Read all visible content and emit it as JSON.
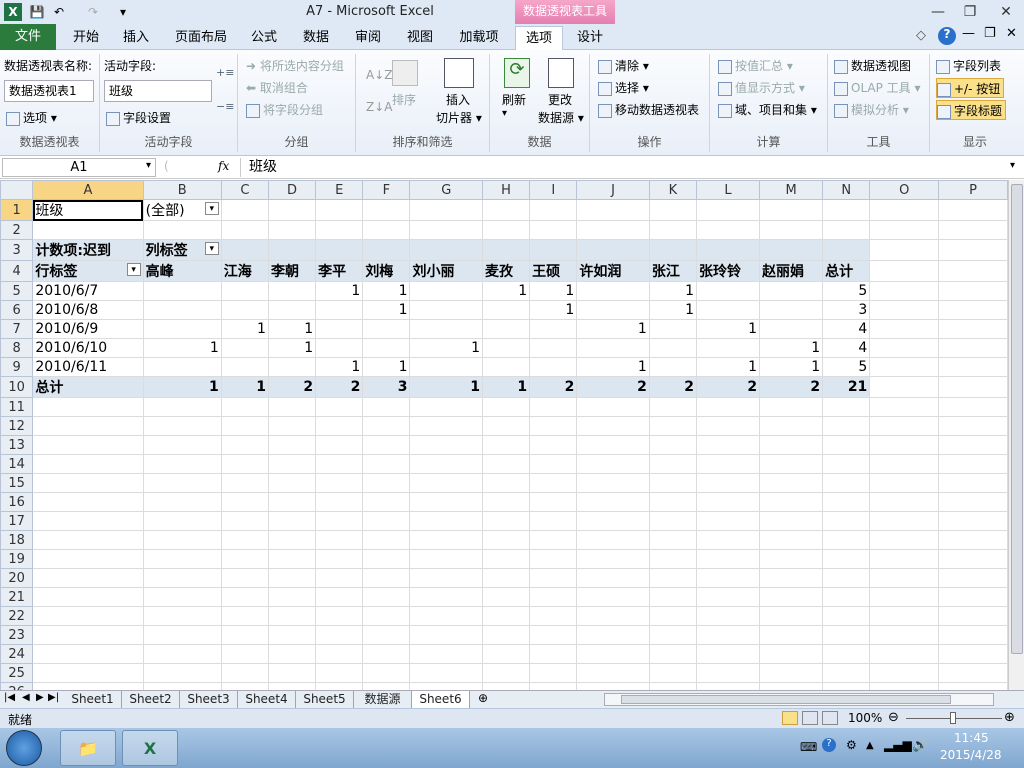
{
  "window": {
    "title": "A7  -  Microsoft Excel",
    "context_tab_title": "数据透视表工具"
  },
  "qat": {
    "save_icon": "save-icon",
    "undo_icon": "undo-icon",
    "redo_icon": "redo-icon",
    "customize_icon": "chevron-down-icon"
  },
  "window_controls": {
    "minimize": "—",
    "restore": "❐",
    "close": "✕"
  },
  "tabs": {
    "file": "文件",
    "home": "开始",
    "insert": "插入",
    "page_layout": "页面布局",
    "formulas": "公式",
    "data": "数据",
    "review": "审阅",
    "view": "视图",
    "addins": "加载项",
    "options": "选项",
    "design": "设计"
  },
  "ribbon": {
    "pivottable": {
      "name_label": "数据透视表名称:",
      "name_value": "数据透视表1",
      "options": "选项 ▾",
      "group": "数据透视表"
    },
    "active_field": {
      "label": "活动字段:",
      "value": "班级",
      "settings": "字段设置",
      "group": "活动字段"
    },
    "group": {
      "group_selection": "将所选内容分组",
      "ungroup": "取消组合",
      "group_field": "将字段分组",
      "group": "分组"
    },
    "sort": {
      "sort": "排序",
      "insert_slicer": "插入",
      "insert_slicer2": "切片器 ▾",
      "group": "排序和筛选"
    },
    "data": {
      "refresh": "刷新",
      "change_source": "更改",
      "change_source2": "数据源 ▾",
      "group": "数据"
    },
    "actions": {
      "clear": "清除 ▾",
      "select": "选择 ▾",
      "move": "移动数据透视表",
      "group": "操作"
    },
    "calculations": {
      "summarize": "按值汇总 ▾",
      "show_values": "值显示方式 ▾",
      "fields_items": "域、项目和集 ▾",
      "group": "计算"
    },
    "tools": {
      "pivotchart": "数据透视图",
      "olap": "OLAP 工具 ▾",
      "whatif": "模拟分析 ▾",
      "group": "工具"
    },
    "show": {
      "field_list": "字段列表",
      "buttons": "+/- 按钮",
      "headers": "字段标题",
      "group": "显示"
    }
  },
  "formula_bar": {
    "name_box": "A1",
    "fx": "fx",
    "content": "班级"
  },
  "columns": [
    "A",
    "B",
    "C",
    "D",
    "E",
    "F",
    "G",
    "H",
    "I",
    "J",
    "K",
    "L",
    "M",
    "N",
    "O",
    "P"
  ],
  "rows": [
    [
      "班级",
      "(全部)",
      "",
      "",
      "",
      "",
      "",
      "",
      "",
      "",
      "",
      "",
      "",
      "",
      "",
      ""
    ],
    [
      "",
      "",
      "",
      "",
      "",
      "",
      "",
      "",
      "",
      "",
      "",
      "",
      "",
      "",
      "",
      ""
    ],
    [
      "计数项:迟到",
      "列标签",
      "",
      "",
      "",
      "",
      "",
      "",
      "",
      "",
      "",
      "",
      "",
      "",
      "",
      ""
    ],
    [
      "行标签",
      "高峰",
      "江海",
      "李朝",
      "李平",
      "刘梅",
      "刘小丽",
      "麦孜",
      "王硕",
      "许如润",
      "张江",
      "张玲铃",
      "赵丽娟",
      "总计",
      "",
      ""
    ],
    [
      "2010/6/7",
      "",
      "",
      "",
      "1",
      "1",
      "",
      "1",
      "1",
      "",
      "1",
      "",
      "",
      "5",
      "",
      ""
    ],
    [
      "2010/6/8",
      "",
      "",
      "",
      "",
      "1",
      "",
      "",
      "1",
      "",
      "1",
      "",
      "",
      "3",
      "",
      ""
    ],
    [
      "2010/6/9",
      "",
      "1",
      "1",
      "",
      "",
      "",
      "",
      "",
      "1",
      "",
      "1",
      "",
      "4",
      "",
      ""
    ],
    [
      "2010/6/10",
      "1",
      "",
      "1",
      "",
      "",
      "1",
      "",
      "",
      "",
      "",
      "",
      "1",
      "4",
      "",
      ""
    ],
    [
      "2010/6/11",
      "",
      "",
      "",
      "1",
      "1",
      "",
      "",
      "",
      "1",
      "",
      "1",
      "1",
      "5",
      "",
      ""
    ],
    [
      "总计",
      "1",
      "1",
      "2",
      "2",
      "3",
      "1",
      "1",
      "2",
      "2",
      "2",
      "2",
      "2",
      "21",
      "",
      ""
    ]
  ],
  "empty_row_count": 16,
  "sheets": [
    "Sheet1",
    "Sheet2",
    "Sheet3",
    "Sheet4",
    "Sheet5",
    "数据源",
    "Sheet6"
  ],
  "active_sheet": "Sheet6",
  "status": {
    "ready": "就绪",
    "zoom": "100%"
  },
  "taskbar": {
    "time": "11:45",
    "date": "2015/4/28"
  }
}
